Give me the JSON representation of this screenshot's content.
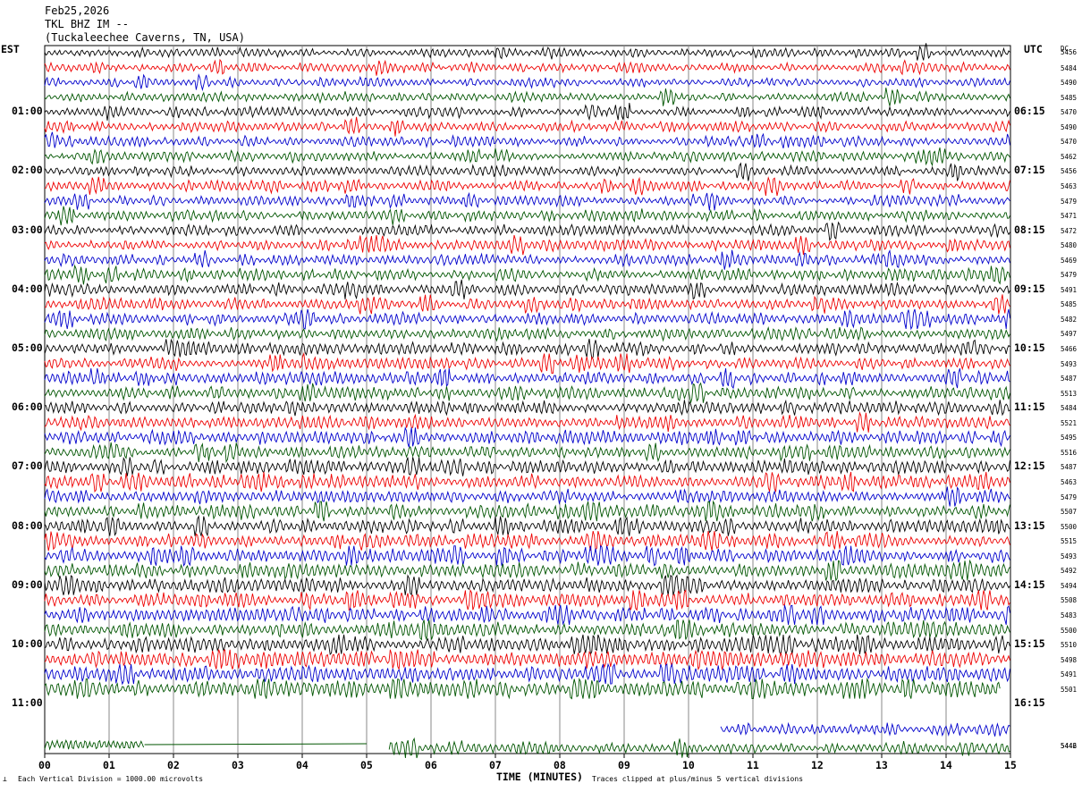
{
  "chart_data": {
    "type": "line",
    "title": [
      "Feb25,2026",
      "TKL BHZ IM --",
      "(Tuckaleechee Caverns, TN, USA)"
    ],
    "left_tz": "EST",
    "right_tz": "UTC",
    "dc_label": "DC",
    "xlabel": "TIME (MINUTES)",
    "x_ticks": [
      "00",
      "01",
      "02",
      "03",
      "04",
      "05",
      "06",
      "07",
      "08",
      "09",
      "10",
      "11",
      "12",
      "13",
      "14",
      "15"
    ],
    "xlim": [
      0,
      15
    ],
    "grid": "vertical-minute-lines",
    "trace_colors": [
      "#000000",
      "#ee0000",
      "#0000cc",
      "#005500"
    ],
    "hour_labels_left": [
      "01:00",
      "02:00",
      "03:00",
      "04:00",
      "05:00",
      "06:00",
      "07:00",
      "08:00",
      "09:00",
      "10:00",
      "11:00"
    ],
    "hour_labels_right": [
      "06:15",
      "07:15",
      "08:15",
      "09:15",
      "10:15",
      "11:15",
      "12:15",
      "13:15",
      "14:15",
      "15:15",
      "16:15"
    ],
    "dc_offsets": [
      5456,
      5484,
      5490,
      5485,
      5470,
      5490,
      5470,
      5462,
      5456,
      5463,
      5479,
      5471,
      5472,
      5480,
      5469,
      5479,
      5491,
      5485,
      5482,
      5497,
      5466,
      5493,
      5487,
      5513,
      5484,
      5521,
      5495,
      5516,
      5487,
      5463,
      5479,
      5507,
      5500,
      5515,
      5493,
      5492,
      5494,
      5508,
      5483,
      5500,
      5510,
      5498,
      5491,
      5501,
      5446,
      5442
    ],
    "footer_left": "Each Vertical Division = 1000.00 microvolts",
    "footer_right": "Traces clipped at plus/minus 5 vertical divisions"
  }
}
